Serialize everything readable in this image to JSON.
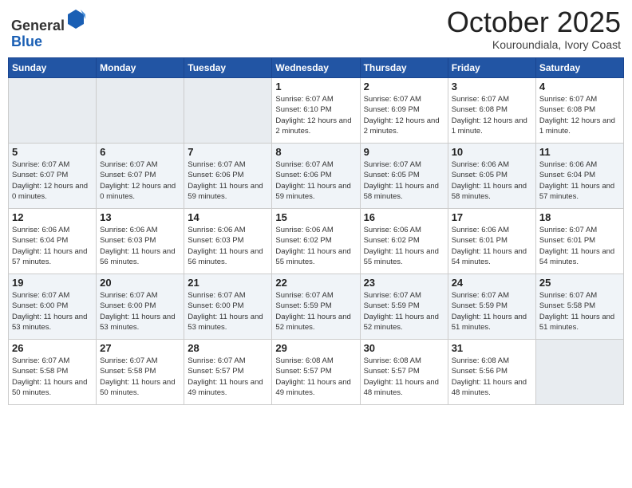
{
  "header": {
    "logo_line1": "General",
    "logo_line2": "Blue",
    "month_title": "October 2025",
    "location": "Kouroundiala, Ivory Coast"
  },
  "days_of_week": [
    "Sunday",
    "Monday",
    "Tuesday",
    "Wednesday",
    "Thursday",
    "Friday",
    "Saturday"
  ],
  "weeks": [
    [
      {
        "day": "",
        "info": ""
      },
      {
        "day": "",
        "info": ""
      },
      {
        "day": "",
        "info": ""
      },
      {
        "day": "1",
        "info": "Sunrise: 6:07 AM\nSunset: 6:10 PM\nDaylight: 12 hours\nand 2 minutes."
      },
      {
        "day": "2",
        "info": "Sunrise: 6:07 AM\nSunset: 6:09 PM\nDaylight: 12 hours\nand 2 minutes."
      },
      {
        "day": "3",
        "info": "Sunrise: 6:07 AM\nSunset: 6:08 PM\nDaylight: 12 hours\nand 1 minute."
      },
      {
        "day": "4",
        "info": "Sunrise: 6:07 AM\nSunset: 6:08 PM\nDaylight: 12 hours\nand 1 minute."
      }
    ],
    [
      {
        "day": "5",
        "info": "Sunrise: 6:07 AM\nSunset: 6:07 PM\nDaylight: 12 hours\nand 0 minutes."
      },
      {
        "day": "6",
        "info": "Sunrise: 6:07 AM\nSunset: 6:07 PM\nDaylight: 12 hours\nand 0 minutes."
      },
      {
        "day": "7",
        "info": "Sunrise: 6:07 AM\nSunset: 6:06 PM\nDaylight: 11 hours\nand 59 minutes."
      },
      {
        "day": "8",
        "info": "Sunrise: 6:07 AM\nSunset: 6:06 PM\nDaylight: 11 hours\nand 59 minutes."
      },
      {
        "day": "9",
        "info": "Sunrise: 6:07 AM\nSunset: 6:05 PM\nDaylight: 11 hours\nand 58 minutes."
      },
      {
        "day": "10",
        "info": "Sunrise: 6:06 AM\nSunset: 6:05 PM\nDaylight: 11 hours\nand 58 minutes."
      },
      {
        "day": "11",
        "info": "Sunrise: 6:06 AM\nSunset: 6:04 PM\nDaylight: 11 hours\nand 57 minutes."
      }
    ],
    [
      {
        "day": "12",
        "info": "Sunrise: 6:06 AM\nSunset: 6:04 PM\nDaylight: 11 hours\nand 57 minutes."
      },
      {
        "day": "13",
        "info": "Sunrise: 6:06 AM\nSunset: 6:03 PM\nDaylight: 11 hours\nand 56 minutes."
      },
      {
        "day": "14",
        "info": "Sunrise: 6:06 AM\nSunset: 6:03 PM\nDaylight: 11 hours\nand 56 minutes."
      },
      {
        "day": "15",
        "info": "Sunrise: 6:06 AM\nSunset: 6:02 PM\nDaylight: 11 hours\nand 55 minutes."
      },
      {
        "day": "16",
        "info": "Sunrise: 6:06 AM\nSunset: 6:02 PM\nDaylight: 11 hours\nand 55 minutes."
      },
      {
        "day": "17",
        "info": "Sunrise: 6:06 AM\nSunset: 6:01 PM\nDaylight: 11 hours\nand 54 minutes."
      },
      {
        "day": "18",
        "info": "Sunrise: 6:07 AM\nSunset: 6:01 PM\nDaylight: 11 hours\nand 54 minutes."
      }
    ],
    [
      {
        "day": "19",
        "info": "Sunrise: 6:07 AM\nSunset: 6:00 PM\nDaylight: 11 hours\nand 53 minutes."
      },
      {
        "day": "20",
        "info": "Sunrise: 6:07 AM\nSunset: 6:00 PM\nDaylight: 11 hours\nand 53 minutes."
      },
      {
        "day": "21",
        "info": "Sunrise: 6:07 AM\nSunset: 6:00 PM\nDaylight: 11 hours\nand 53 minutes."
      },
      {
        "day": "22",
        "info": "Sunrise: 6:07 AM\nSunset: 5:59 PM\nDaylight: 11 hours\nand 52 minutes."
      },
      {
        "day": "23",
        "info": "Sunrise: 6:07 AM\nSunset: 5:59 PM\nDaylight: 11 hours\nand 52 minutes."
      },
      {
        "day": "24",
        "info": "Sunrise: 6:07 AM\nSunset: 5:59 PM\nDaylight: 11 hours\nand 51 minutes."
      },
      {
        "day": "25",
        "info": "Sunrise: 6:07 AM\nSunset: 5:58 PM\nDaylight: 11 hours\nand 51 minutes."
      }
    ],
    [
      {
        "day": "26",
        "info": "Sunrise: 6:07 AM\nSunset: 5:58 PM\nDaylight: 11 hours\nand 50 minutes."
      },
      {
        "day": "27",
        "info": "Sunrise: 6:07 AM\nSunset: 5:58 PM\nDaylight: 11 hours\nand 50 minutes."
      },
      {
        "day": "28",
        "info": "Sunrise: 6:07 AM\nSunset: 5:57 PM\nDaylight: 11 hours\nand 49 minutes."
      },
      {
        "day": "29",
        "info": "Sunrise: 6:08 AM\nSunset: 5:57 PM\nDaylight: 11 hours\nand 49 minutes."
      },
      {
        "day": "30",
        "info": "Sunrise: 6:08 AM\nSunset: 5:57 PM\nDaylight: 11 hours\nand 48 minutes."
      },
      {
        "day": "31",
        "info": "Sunrise: 6:08 AM\nSunset: 5:56 PM\nDaylight: 11 hours\nand 48 minutes."
      },
      {
        "day": "",
        "info": ""
      }
    ]
  ]
}
